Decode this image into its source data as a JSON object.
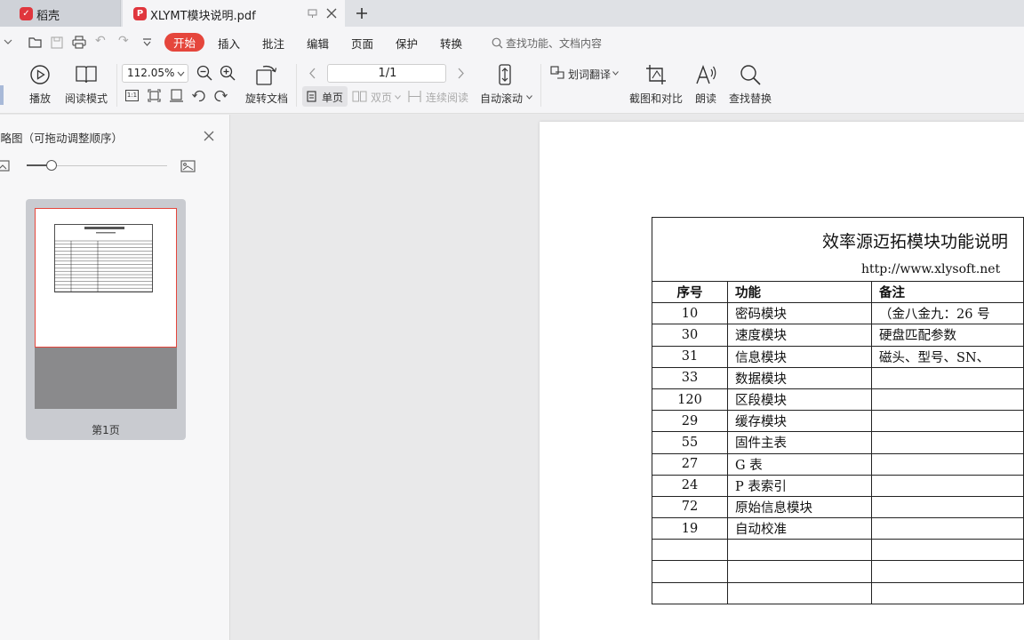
{
  "tabs": [
    {
      "label": "稻壳",
      "icon": "daoke-icon"
    },
    {
      "label": "XLYMT模块说明.pdf",
      "icon": "pdf-icon"
    }
  ],
  "menu": {
    "items": [
      "开始",
      "插入",
      "批注",
      "编辑",
      "页面",
      "保护",
      "转换"
    ],
    "active": "开始",
    "search_placeholder": "查找功能、文档内容"
  },
  "toolbar": {
    "play": "播放",
    "read_mode": "阅读模式",
    "zoom": "112.05%",
    "rotate_doc": "旋转文档",
    "page_value": "1/1",
    "single_page": "单页",
    "double_page": "双页",
    "continuous": "连续阅读",
    "auto_scroll": "自动滚动",
    "word_translate": "划词翻译",
    "screenshot_compare": "截图和对比",
    "read_aloud": "朗读",
    "find_replace": "查找替换",
    "fit_label": "1:1"
  },
  "thumbnail_panel": {
    "title": "缩略图（可拖动调整顺序）",
    "page_label": "第1页",
    "slider_level": 0.18
  },
  "document": {
    "title": "效率源迈拓模块功能说明",
    "url": "http://www.xlysoft.net",
    "headers": [
      "序号",
      "功能",
      "备注"
    ],
    "rows": [
      [
        "10",
        "密码模块",
        "（金八金九：26 号"
      ],
      [
        "30",
        "速度模块",
        "硬盘匹配参数"
      ],
      [
        "31",
        "信息模块",
        "磁头、型号、SN、"
      ],
      [
        "33",
        "数据模块",
        ""
      ],
      [
        "120",
        "区段模块",
        ""
      ],
      [
        "29",
        "缓存模块",
        ""
      ],
      [
        "55",
        "固件主表",
        ""
      ],
      [
        "27",
        "G 表",
        ""
      ],
      [
        "24",
        "P 表索引",
        ""
      ],
      [
        "72",
        "原始信息模块",
        ""
      ],
      [
        "19",
        "自动校准",
        ""
      ],
      [
        "",
        "",
        ""
      ],
      [
        "",
        "",
        ""
      ],
      [
        "",
        "",
        ""
      ]
    ]
  },
  "colors": {
    "accent": "#e5463c",
    "panel": "#f7f7f8",
    "workspace": "#e9e9ea"
  }
}
